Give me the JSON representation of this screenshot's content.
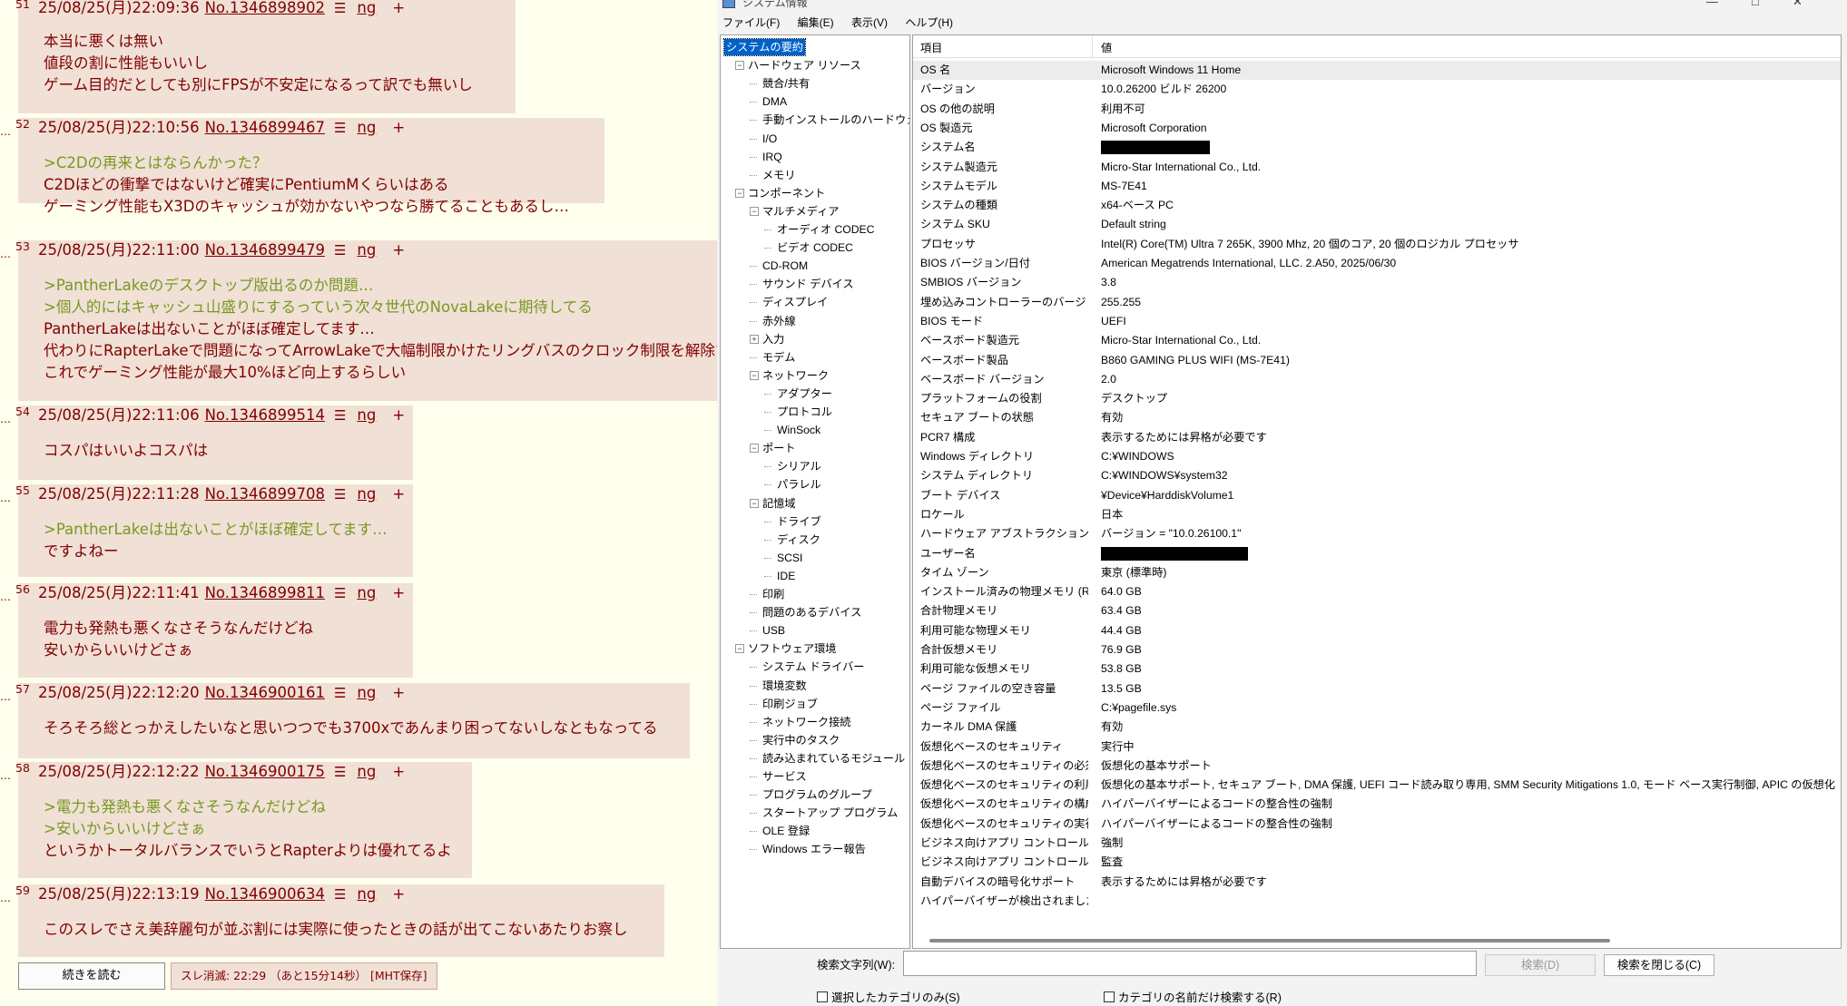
{
  "thread": {
    "posts": [
      {
        "num": "51",
        "date": "25/08/25(月)22:09:36",
        "no": "No.1346898902",
        "lines": [
          {
            "text": "本当に悪くは無い",
            "quote": false
          },
          {
            "text": "値段の割に性能もいいし",
            "quote": false
          },
          {
            "text": "ゲーム目的だとしても別にFPSが不安定になるって訳でも無いし",
            "quote": false
          }
        ]
      },
      {
        "num": "52",
        "date": "25/08/25(月)22:10:56",
        "no": "No.1346899467",
        "lines": [
          {
            "text": ">C2Dの再来とはならんかった？",
            "quote": true
          },
          {
            "text": "C2Dほどの衝撃ではないけど確実にPentiumMくらいはある",
            "quote": false
          },
          {
            "text": "ゲーミング性能もX3Dのキャッシュが効かないやつなら勝てることもあるし…",
            "quote": false
          }
        ]
      },
      {
        "num": "53",
        "date": "25/08/25(月)22:11:00",
        "no": "No.1346899479",
        "lines": [
          {
            "text": ">PantherLakeのデスクトップ版出るのか問題…",
            "quote": true
          },
          {
            "text": ">個人的にはキャッシュ山盛りにするっていう次々世代のNovaLakeに期待してる",
            "quote": true
          },
          {
            "text": "PantherLakeは出ないことがほぼ確定してます…",
            "quote": false
          },
          {
            "text": "代わりにRapterLakeで問題になってArrowLakeで大幅制限かけたリングバスのクロック制限を解除する",
            "quote": false
          },
          {
            "text": "これでゲーミング性能が最大10%ほど向上するらしい",
            "quote": false
          }
        ]
      },
      {
        "num": "54",
        "date": "25/08/25(月)22:11:06",
        "no": "No.1346899514",
        "lines": [
          {
            "text": "コスパはいいよコスパは",
            "quote": false
          }
        ]
      },
      {
        "num": "55",
        "date": "25/08/25(月)22:11:28",
        "no": "No.1346899708",
        "lines": [
          {
            "text": ">PantherLakeは出ないことがほぼ確定してます…",
            "quote": true
          },
          {
            "text": "ですよねー",
            "quote": false
          }
        ]
      },
      {
        "num": "56",
        "date": "25/08/25(月)22:11:41",
        "no": "No.1346899811",
        "lines": [
          {
            "text": "電力も発熱も悪くなさそうなんだけどね",
            "quote": false
          },
          {
            "text": "安いからいいけどさぁ",
            "quote": false
          }
        ]
      },
      {
        "num": "57",
        "date": "25/08/25(月)22:12:20",
        "no": "No.1346900161",
        "lines": [
          {
            "text": "そろそろ総とっかえしたいなと思いつつでも3700xであんまり困ってないしなともなってる",
            "quote": false
          }
        ]
      },
      {
        "num": "58",
        "date": "25/08/25(月)22:12:22",
        "no": "No.1346900175",
        "lines": [
          {
            "text": ">電力も発熱も悪くなさそうなんだけどね",
            "quote": true
          },
          {
            "text": ">安いからいいけどさぁ",
            "quote": true
          },
          {
            "text": "というかトータルバランスでいうとRapterよりは優れてるよ",
            "quote": false
          }
        ]
      },
      {
        "num": "59",
        "date": "25/08/25(月)22:13:19",
        "no": "No.1346900634",
        "lines": [
          {
            "text": "このスレでさえ美辞麗句が並ぶ割には実際に使ったときの話が出てこないあたりお察し",
            "quote": false
          }
        ]
      }
    ],
    "menu_glyph": "☰",
    "ng_label": "ng",
    "plus_label": "+",
    "dots": "…",
    "read_more": "続きを読む",
    "expire": "スレ消滅: 22:29 （あと15分14秒） [MHT保存]"
  },
  "window": {
    "title": "システム情報",
    "min_glyph": "—",
    "max_glyph": "□",
    "close_glyph": "✕",
    "menu": [
      "ファイル(F)",
      "編集(E)",
      "表示(V)",
      "ヘルプ(H)"
    ],
    "tree": [
      {
        "label": "システムの要約",
        "depth": 0,
        "expander": "",
        "selected": true
      },
      {
        "label": "ハードウェア リソース",
        "depth": 1,
        "expander": "−"
      },
      {
        "label": "競合/共有",
        "depth": 2,
        "expander": ""
      },
      {
        "label": "DMA",
        "depth": 2,
        "expander": ""
      },
      {
        "label": "手動インストールのハードウェア",
        "depth": 2,
        "expander": ""
      },
      {
        "label": "I/O",
        "depth": 2,
        "expander": ""
      },
      {
        "label": "IRQ",
        "depth": 2,
        "expander": ""
      },
      {
        "label": "メモリ",
        "depth": 2,
        "expander": ""
      },
      {
        "label": "コンポーネント",
        "depth": 1,
        "expander": "−"
      },
      {
        "label": "マルチメディア",
        "depth": 2,
        "expander": "−"
      },
      {
        "label": "オーディオ CODEC",
        "depth": 3,
        "expander": ""
      },
      {
        "label": "ビデオ CODEC",
        "depth": 3,
        "expander": ""
      },
      {
        "label": "CD-ROM",
        "depth": 2,
        "expander": ""
      },
      {
        "label": "サウンド デバイス",
        "depth": 2,
        "expander": ""
      },
      {
        "label": "ディスプレイ",
        "depth": 2,
        "expander": ""
      },
      {
        "label": "赤外線",
        "depth": 2,
        "expander": ""
      },
      {
        "label": "入力",
        "depth": 2,
        "expander": "+"
      },
      {
        "label": "モデム",
        "depth": 2,
        "expander": ""
      },
      {
        "label": "ネットワーク",
        "depth": 2,
        "expander": "−"
      },
      {
        "label": "アダプター",
        "depth": 3,
        "expander": ""
      },
      {
        "label": "プロトコル",
        "depth": 3,
        "expander": ""
      },
      {
        "label": "WinSock",
        "depth": 3,
        "expander": ""
      },
      {
        "label": "ポート",
        "depth": 2,
        "expander": "−"
      },
      {
        "label": "シリアル",
        "depth": 3,
        "expander": ""
      },
      {
        "label": "パラレル",
        "depth": 3,
        "expander": ""
      },
      {
        "label": "記憶域",
        "depth": 2,
        "expander": "−"
      },
      {
        "label": "ドライブ",
        "depth": 3,
        "expander": ""
      },
      {
        "label": "ディスク",
        "depth": 3,
        "expander": ""
      },
      {
        "label": "SCSI",
        "depth": 3,
        "expander": ""
      },
      {
        "label": "IDE",
        "depth": 3,
        "expander": ""
      },
      {
        "label": "印刷",
        "depth": 2,
        "expander": ""
      },
      {
        "label": "問題のあるデバイス",
        "depth": 2,
        "expander": ""
      },
      {
        "label": "USB",
        "depth": 2,
        "expander": ""
      },
      {
        "label": "ソフトウェア環境",
        "depth": 1,
        "expander": "−"
      },
      {
        "label": "システム ドライバー",
        "depth": 2,
        "expander": ""
      },
      {
        "label": "環境変数",
        "depth": 2,
        "expander": ""
      },
      {
        "label": "印刷ジョブ",
        "depth": 2,
        "expander": ""
      },
      {
        "label": "ネットワーク接続",
        "depth": 2,
        "expander": ""
      },
      {
        "label": "実行中のタスク",
        "depth": 2,
        "expander": ""
      },
      {
        "label": "読み込まれているモジュール",
        "depth": 2,
        "expander": ""
      },
      {
        "label": "サービス",
        "depth": 2,
        "expander": ""
      },
      {
        "label": "プログラムのグループ",
        "depth": 2,
        "expander": ""
      },
      {
        "label": "スタートアップ プログラム",
        "depth": 2,
        "expander": ""
      },
      {
        "label": "OLE 登録",
        "depth": 2,
        "expander": ""
      },
      {
        "label": "Windows エラー報告",
        "depth": 2,
        "expander": ""
      }
    ],
    "grid": {
      "col_item": "項目",
      "col_value": "値",
      "rows": [
        {
          "k": "OS 名",
          "v": "Microsoft Windows 11 Home"
        },
        {
          "k": "バージョン",
          "v": "10.0.26200 ビルド 26200"
        },
        {
          "k": "OS の他の説明",
          "v": "利用不可"
        },
        {
          "k": "OS 製造元",
          "v": "Microsoft Corporation"
        },
        {
          "k": "システム名",
          "v": "",
          "redacted": true,
          "redact_w": 120
        },
        {
          "k": "システム製造元",
          "v": "Micro-Star International Co., Ltd."
        },
        {
          "k": "システムモデル",
          "v": "MS-7E41"
        },
        {
          "k": "システムの種類",
          "v": "x64-ベース PC"
        },
        {
          "k": "システム SKU",
          "v": "Default string"
        },
        {
          "k": "プロセッサ",
          "v": "Intel(R) Core(TM) Ultra 7 265K, 3900 Mhz, 20 個のコア, 20 個のロジカル プロセッサ"
        },
        {
          "k": "BIOS バージョン/日付",
          "v": "American Megatrends International, LLC. 2.A50, 2025/06/30"
        },
        {
          "k": "SMBIOS バージョン",
          "v": "3.8"
        },
        {
          "k": "埋め込みコントローラーのバージョン",
          "v": "255.255"
        },
        {
          "k": "BIOS モード",
          "v": "UEFI"
        },
        {
          "k": "ベースボード製造元",
          "v": "Micro-Star International Co., Ltd."
        },
        {
          "k": "ベースボード製品",
          "v": "B860 GAMING PLUS WIFI (MS-7E41)"
        },
        {
          "k": "ベースボード バージョン",
          "v": "2.0"
        },
        {
          "k": "プラットフォームの役割",
          "v": "デスクトップ"
        },
        {
          "k": "セキュア ブートの状態",
          "v": "有効"
        },
        {
          "k": "PCR7 構成",
          "v": "表示するためには昇格が必要です"
        },
        {
          "k": "Windows ディレクトリ",
          "v": "C:¥WINDOWS"
        },
        {
          "k": "システム ディレクトリ",
          "v": "C:¥WINDOWS¥system32"
        },
        {
          "k": "ブート デバイス",
          "v": "¥Device¥HarddiskVolume1"
        },
        {
          "k": "ロケール",
          "v": "日本"
        },
        {
          "k": "ハードウェア アブストラクション レイヤー",
          "v": "バージョン = \"10.0.26100.1\""
        },
        {
          "k": "ユーザー名",
          "v": "",
          "redacted": true,
          "redact_w": 162
        },
        {
          "k": "タイム ゾーン",
          "v": "東京 (標準時)"
        },
        {
          "k": "インストール済みの物理メモリ (RAM)",
          "v": "64.0 GB"
        },
        {
          "k": "合計物理メモリ",
          "v": "63.4 GB"
        },
        {
          "k": "利用可能な物理メモリ",
          "v": "44.4 GB"
        },
        {
          "k": "合計仮想メモリ",
          "v": "76.9 GB"
        },
        {
          "k": "利用可能な仮想メモリ",
          "v": "53.8 GB"
        },
        {
          "k": "ページ ファイルの空き容量",
          "v": "13.5 GB"
        },
        {
          "k": "ページ ファイル",
          "v": "C:¥pagefile.sys"
        },
        {
          "k": "カーネル DMA 保護",
          "v": "有効"
        },
        {
          "k": "仮想化ベースのセキュリティ",
          "v": "実行中"
        },
        {
          "k": "仮想化ベースのセキュリティの必須セ…",
          "v": "仮想化の基本サポート"
        },
        {
          "k": "仮想化ベースのセキュリティの利用…",
          "v": "仮想化の基本サポート, セキュア ブート, DMA 保護, UEFI コード読み取り専用, SMM Security Mitigations 1.0, モード ベース実行制御, APIC の仮想化"
        },
        {
          "k": "仮想化ベースのセキュリティの構成…",
          "v": "ハイパーバイザーによるコードの整合性の強制"
        },
        {
          "k": "仮想化ベースのセキュリティの実行…",
          "v": "ハイパーバイザーによるコードの整合性の強制"
        },
        {
          "k": "ビジネス向けアプリ コントロール ポリ…",
          "v": "強制"
        },
        {
          "k": "ビジネス向けアプリ コントロールのユー…",
          "v": "監査"
        },
        {
          "k": "自動デバイスの暗号化サポート",
          "v": "表示するためには昇格が必要です"
        },
        {
          "k": "ハイパーバイザーが検出されました。H…",
          "v": ""
        }
      ]
    },
    "search_label": "検索文字列(W):",
    "search_value": "",
    "search_button": "検索(D)",
    "close_search_button": "検索を閉じる(C)",
    "chk_selected_only": "選択したカテゴリのみ(S)",
    "chk_names_only": "カテゴリの名前だけ検索する(R)"
  }
}
